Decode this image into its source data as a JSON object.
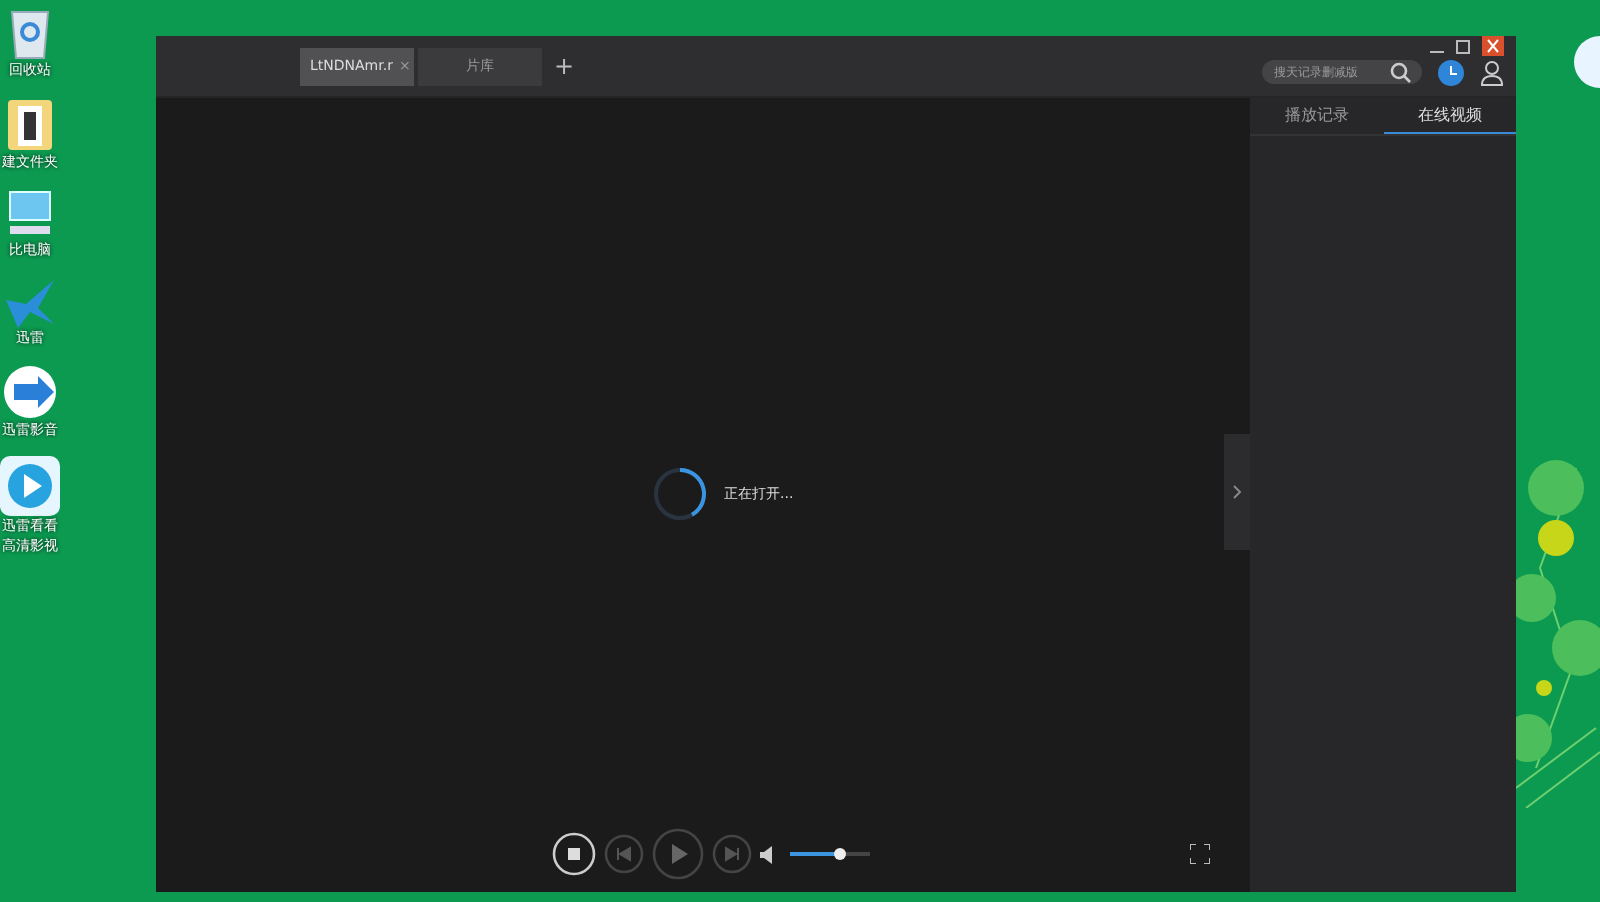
{
  "desktop_icons": [
    {
      "kind": "recycle",
      "label": "回收站"
    },
    {
      "kind": "folder",
      "label": "建文件夹"
    },
    {
      "kind": "computer",
      "label": "比电脑"
    },
    {
      "kind": "bird",
      "label": "迅雷"
    },
    {
      "kind": "player",
      "label": "迅雷影音"
    },
    {
      "kind": "video",
      "label": "迅雷看看",
      "label2": "高清影视"
    }
  ],
  "player": {
    "tabs": [
      {
        "label": "LtNDNAmr.r",
        "close": "×",
        "selected": true
      },
      {
        "label": "片库",
        "selected": false
      }
    ],
    "new_tab": "+",
    "search": {
      "placeholder": "搜天记录删减版"
    },
    "side_tabs": [
      {
        "label": "播放记录",
        "selected": false
      },
      {
        "label": "在线视频",
        "selected": true
      }
    ],
    "status": "正在打开...",
    "volume": {
      "level": 0.62
    }
  }
}
